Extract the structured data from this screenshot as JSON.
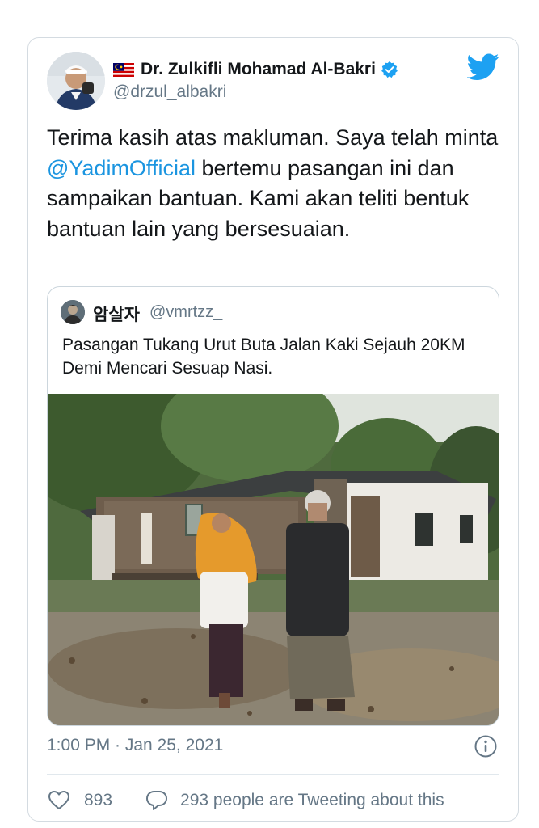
{
  "author": {
    "display_name": "Dr. Zulkifli Mohamad Al-Bakri",
    "handle": "@drzul_albakri"
  },
  "tweet": {
    "text_before": "Terima kasih atas makluman. Saya telah minta ",
    "mention": "@YadimOfficial",
    "text_after": " bertemu pasangan ini dan sampaikan bantuan. Kami akan teliti bentuk bantuan lain yang bersesuaian.",
    "timestamp": "1:00 PM · Jan 25, 2021"
  },
  "quoted_tweet": {
    "display_name": "암살자",
    "handle": "@vmrtzz_",
    "text": "Pasangan Tukang Urut Buta Jalan Kaki Sejauh 20KM Demi Mencari Sesuap Nasi."
  },
  "stats": {
    "likes": "893",
    "conversation": "293 people are Tweeting about this"
  },
  "icons": {
    "brand": "twitter-bird-icon",
    "verified": "verified-badge-icon",
    "flag": "malaysia-flag-icon",
    "info": "info-icon",
    "like": "heart-icon",
    "reply": "speech-bubble-icon"
  },
  "colors": {
    "accent": "#1da1f2",
    "mention": "#1b95e0",
    "secondary_text": "#657786",
    "border": "#d4dbe1"
  }
}
